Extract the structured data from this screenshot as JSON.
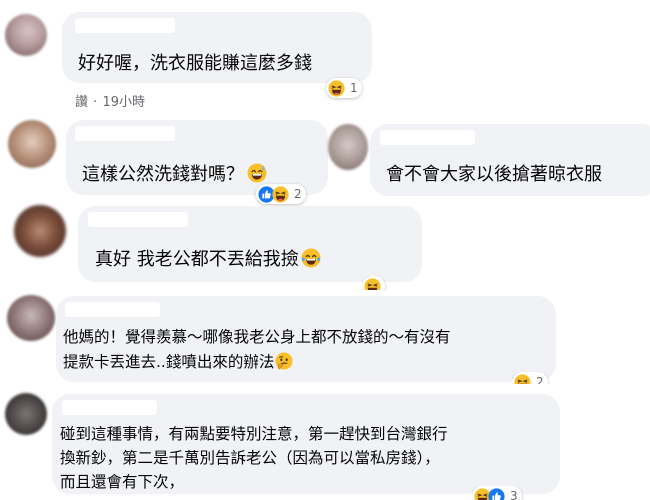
{
  "comments": [
    {
      "text": "好好喔，洗衣服能賺這麼多錢",
      "meta": {
        "action": "讚",
        "separator": "·",
        "time": "19小時"
      },
      "reaction_count": "1"
    },
    {
      "text": "這樣公然洗錢對嗎？",
      "reaction_count": "2"
    },
    {
      "text": "會不會大家以後搶著晾衣服"
    },
    {
      "text": "真好 我老公都不丟給我撿"
    },
    {
      "text_line1": "他媽的！覺得羨慕～哪像我老公身上都不放錢的～有沒有",
      "text_line2": "提款卡丟進去..錢噴出來的辦法",
      "reaction_count": "2"
    },
    {
      "text_line1": "碰到這種事情，有兩點要特別注意，第一趕快到台灣銀行",
      "text_line2": "換新鈔，第二是千萬別告訴老公（因為可以當私房錢），",
      "text_line3": "而且還會有下次，",
      "reaction_count": "3"
    }
  ],
  "icons": {
    "haha": "laughing-face",
    "sweat": "grinning-sweat-face",
    "tears": "tears-of-joy-face",
    "thinking": "thinking-face",
    "like": "thumbs-up"
  },
  "colors": {
    "bubble": "#f0f2f5",
    "meta": "#65676b",
    "like": "#1877f2",
    "emoji": "#f7b125"
  }
}
